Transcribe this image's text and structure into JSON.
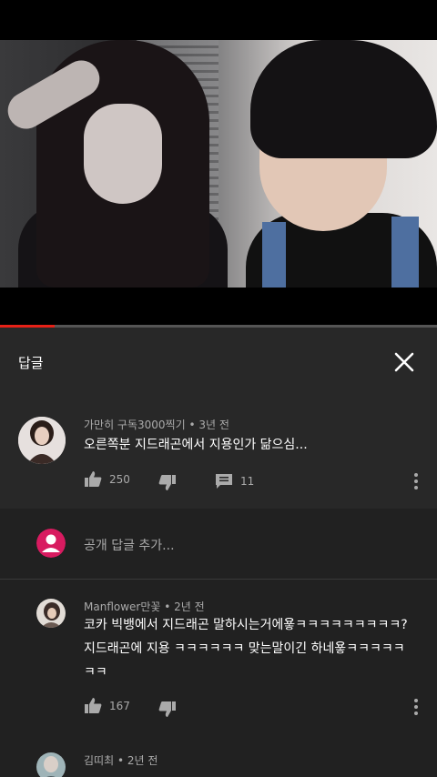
{
  "video": {
    "progress": 0.125
  },
  "panel": {
    "title": "답글"
  },
  "parent_comment": {
    "author": "가만히 구독3000찍기",
    "time": "3년 전",
    "text": "오른쪽분 지드래곤에서 지용인가 닮으심...",
    "likes": "250",
    "replies": "11"
  },
  "add_reply": {
    "placeholder": "공개 답글 추가..."
  },
  "replies": [
    {
      "author": "Manflower만꽃",
      "time": "2년 전",
      "lines": [
        "코카 빅뱅에서 지드래곤 말하시는거에욯ㅋㅋㅋㅋㅋㅋㅋㅋㅋ?",
        "지드래곤에 지용 ㅋㅋㅋㅋㅋㅋ 맞는말이긴 하네욯ㅋㅋㅋㅋㅋ",
        "ㅋㅋ"
      ],
      "likes": "167"
    },
    {
      "author": "김띠최",
      "time": "2년 전"
    }
  ],
  "colors": {
    "accent": "#e62117",
    "avatar_pink": "#d81b60"
  }
}
